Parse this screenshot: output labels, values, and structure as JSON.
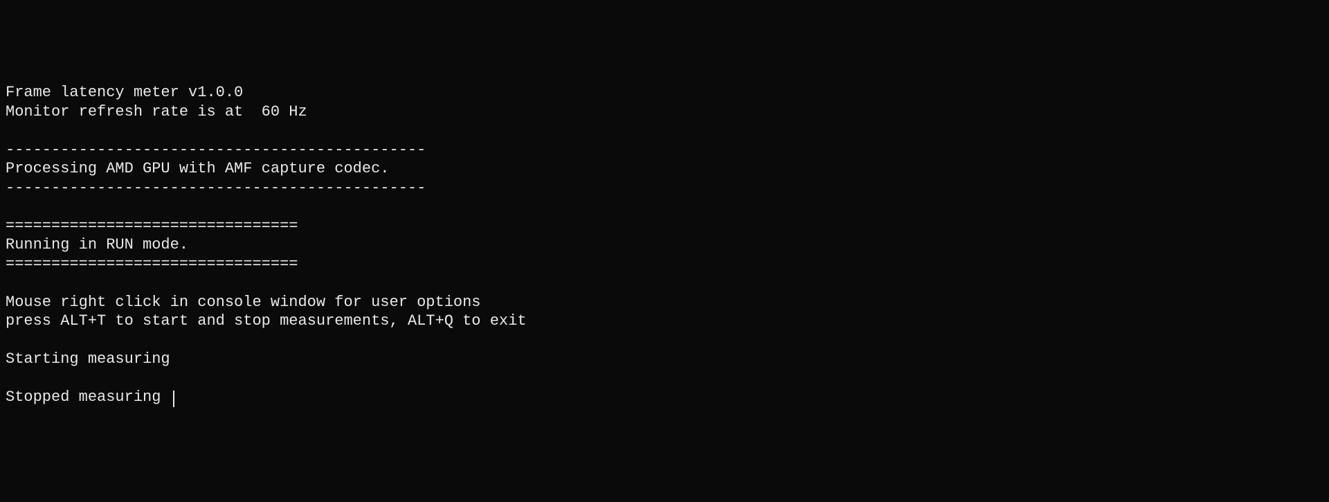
{
  "console": {
    "lines": [
      "Frame latency meter v1.0.0",
      "Monitor refresh rate is at  60 Hz",
      "",
      "----------------------------------------------",
      "Processing AMD GPU with AMF capture codec.",
      "----------------------------------------------",
      "",
      "================================",
      "Running in RUN mode.",
      "================================",
      "",
      "Mouse right click in console window for user options",
      "press ALT+T to start and stop measurements, ALT+Q to exit",
      "",
      "Starting measuring",
      "",
      "Stopped measuring "
    ]
  }
}
